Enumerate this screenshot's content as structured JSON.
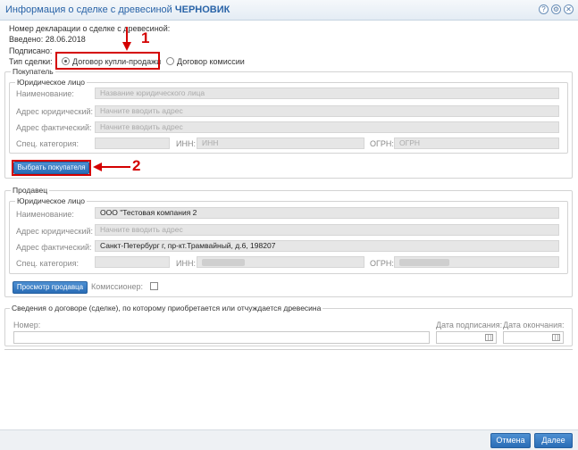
{
  "window": {
    "title_prefix": "Информация о сделке с древесиной",
    "title_status": "ЧЕРНОВИК",
    "icons": [
      "help-icon",
      "settings-icon",
      "close-icon"
    ]
  },
  "header": {
    "declaration_number_label": "Номер декларации о сделке с древесиной:",
    "entered_label": "Введено: 28.06.2018",
    "signed_label": "Подписано:",
    "deal_type_label": "Тип сделки:",
    "deal_types": [
      {
        "label": "Договор купли-продажи",
        "checked": true
      },
      {
        "label": "Договор комиссии",
        "checked": false
      }
    ]
  },
  "buyer": {
    "legend": "Покупатель",
    "entity_legend": "Юридическое лицо",
    "name_label": "Наименование:",
    "name_placeholder": "Название юридического лица",
    "legal_address_label": "Адрес юридический:",
    "legal_address_placeholder": "Начните вводить адрес",
    "actual_address_label": "Адрес фактический:",
    "actual_address_placeholder": "Начните вводить адрес",
    "special_category_label": "Спец. категория:",
    "inn_label": "ИНН:",
    "inn_placeholder": "ИНН",
    "ogrn_label": "ОГРН:",
    "ogrn_placeholder": "ОГРН",
    "select_button": "Выбрать покупателя"
  },
  "seller": {
    "legend": "Продавец",
    "entity_legend": "Юридическое лицо",
    "name_label": "Наименование:",
    "name_value": "ООО \"Тестовая компания 2",
    "legal_address_label": "Адрес юридический:",
    "legal_address_placeholder": "Начните вводить адрес",
    "actual_address_label": "Адрес фактический:",
    "actual_address_value": "Санкт-Петербург г, пр-кт.Трамвайный, д.6, 198207",
    "special_category_label": "Спец. категория:",
    "inn_label": "ИНН:",
    "ogrn_label": "ОГРН:",
    "view_button": "Просмотр продавца",
    "commissioner_label": "Комиссионер:"
  },
  "contract": {
    "legend": "Сведения о договоре (сделке), по которому приобретается или отчуждается древесина",
    "number_label": "Номер:",
    "sign_date_label": "Дата подписания:",
    "end_date_label": "Дата окончания:"
  },
  "annotations": {
    "marker_1": "1",
    "marker_2": "2",
    "color": "#d40000"
  },
  "footer": {
    "cancel_button": "Отмена",
    "next_button": "Далее"
  }
}
